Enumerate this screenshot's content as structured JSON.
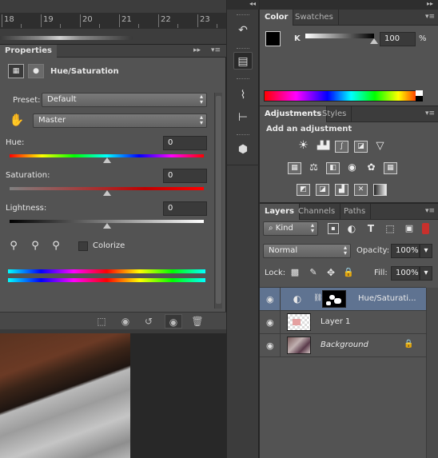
{
  "ruler": {
    "numbers": [
      "18",
      "19",
      "20",
      "21",
      "22",
      "23"
    ]
  },
  "properties": {
    "tab_label": "Properties",
    "panel_title": "Hue/Saturation",
    "preset_label": "Preset:",
    "preset_value": "Default",
    "channel_value": "Master",
    "hue_label": "Hue:",
    "hue_value": "0",
    "saturation_label": "Saturation:",
    "saturation_value": "0",
    "lightness_label": "Lightness:",
    "lightness_value": "0",
    "colorize_label": "Colorize",
    "hue_level": 0.5,
    "saturation_level": 0.5,
    "lightness_level": 0.5
  },
  "color_panel": {
    "tabs": [
      "Color",
      "Swatches"
    ],
    "channel_label": "K",
    "k_value": "100",
    "percent": "%",
    "k_level": 1.0,
    "foreground_color": "#000000",
    "background_color": "#ffffff"
  },
  "adjustments_panel": {
    "tabs": [
      "Adjustments",
      "Styles"
    ],
    "heading": "Add an adjustment",
    "row1": [
      "brightness-contrast-icon",
      "levels-icon",
      "curves-icon",
      "exposure-icon",
      "vibrance-icon"
    ],
    "row2": [
      "hue-saturation-icon",
      "color-balance-icon",
      "black-white-icon",
      "photo-filter-icon",
      "channel-mixer-icon",
      "color-lookup-icon"
    ],
    "row3": [
      "invert-icon",
      "posterize-icon",
      "threshold-icon",
      "selective-color-icon",
      "gradient-map-icon"
    ]
  },
  "layers_panel": {
    "tabs": [
      "Layers",
      "Channels",
      "Paths"
    ],
    "filter_value": "Kind",
    "blend_mode": "Normal",
    "opacity_label": "Opacity:",
    "opacity_value": "100%",
    "lock_label": "Lock:",
    "fill_label": "Fill:",
    "fill_value": "100%",
    "layers": [
      {
        "name": "Hue/Saturati..."
      },
      {
        "name": "Layer 1"
      },
      {
        "name": "Background"
      }
    ]
  },
  "icons": {
    "menu": "panel-menu-icon",
    "collapse": "collapse-double-arrow-icon"
  }
}
